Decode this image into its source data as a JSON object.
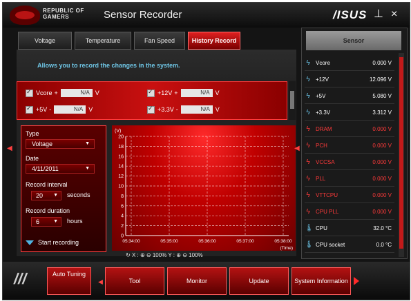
{
  "window": {
    "brand_line1": "REPUBLIC OF",
    "brand_line2": "GAMERS",
    "title": "Sensor Recorder",
    "vendor": "/ISUS",
    "minimize": "⊥",
    "close": "×"
  },
  "tabs": [
    {
      "label": "Voltage"
    },
    {
      "label": "Temperature"
    },
    {
      "label": "Fan Speed"
    },
    {
      "label": "History Record",
      "active": true
    }
  ],
  "description": "Allows you to record the changes in the system.",
  "voltage_items": [
    {
      "label": "Vcore",
      "value": "N/A",
      "unit": "V"
    },
    {
      "label": "+12V",
      "value": "N/A",
      "unit": "V"
    },
    {
      "label": "+5V",
      "value": "N/A",
      "unit": "V"
    },
    {
      "label": "+3.3V",
      "value": "N/A",
      "unit": "V"
    }
  ],
  "record_settings": {
    "type_label": "Type",
    "type_value": "Voltage",
    "date_label": "Date",
    "date_value": "4/11/2011",
    "interval_label": "Record interval",
    "interval_value": "20",
    "interval_unit": "seconds",
    "duration_label": "Record duration",
    "duration_value": "6",
    "duration_unit": "hours",
    "start_label": "Start recording"
  },
  "chart_data": {
    "type": "line",
    "title": "",
    "ylabel": "(V)",
    "ylim": [
      0,
      20
    ],
    "y_ticks": [
      0,
      2,
      4,
      6,
      8,
      10,
      12,
      14,
      16,
      18,
      20
    ],
    "x_ticks": [
      "05:34:00",
      "05:35:00",
      "05:36:00",
      "05:37:00",
      "05:38:00"
    ],
    "xlabel": "(Time)",
    "series": [],
    "grid": true
  },
  "graph_controls": {
    "x_label": "X :",
    "x_zoom": "100%",
    "y_label": "Y :",
    "y_zoom": "100%"
  },
  "sensors": {
    "header": "Sensor",
    "rows": [
      {
        "icon": "bolt-icon",
        "name": "Vcore",
        "value": "0.000",
        "unit": "V",
        "status": "normal"
      },
      {
        "icon": "bolt-icon",
        "name": "+12V",
        "value": "12.096",
        "unit": "V",
        "status": "normal"
      },
      {
        "icon": "bolt-icon",
        "name": "+5V",
        "value": "5.080",
        "unit": "V",
        "status": "normal"
      },
      {
        "icon": "bolt-icon",
        "name": "+3.3V",
        "value": "3.312",
        "unit": "V",
        "status": "normal"
      },
      {
        "icon": "bolt-icon",
        "name": "DRAM",
        "value": "0.000",
        "unit": "V",
        "status": "warning"
      },
      {
        "icon": "bolt-icon",
        "name": "PCH",
        "value": "0.000",
        "unit": "V",
        "status": "warning"
      },
      {
        "icon": "bolt-icon",
        "name": "VCCSA",
        "value": "0.000",
        "unit": "V",
        "status": "warning"
      },
      {
        "icon": "bolt-icon",
        "name": "PLL",
        "value": "0.000",
        "unit": "V",
        "status": "warning"
      },
      {
        "icon": "bolt-icon",
        "name": "VTTCPU",
        "value": "0.000",
        "unit": "V",
        "status": "warning"
      },
      {
        "icon": "bolt-icon",
        "name": "CPU PLL",
        "value": "0.000",
        "unit": "V",
        "status": "warning"
      },
      {
        "icon": "thermometer-icon",
        "name": "CPU",
        "value": "32.0",
        "unit": "°C",
        "status": "normal"
      },
      {
        "icon": "thermometer-icon",
        "name": "CPU socket",
        "value": "0.0",
        "unit": "°C",
        "status": "normal"
      }
    ]
  },
  "bottom_bar": {
    "auto_tuning": "Auto Tuning",
    "tool": "Tool",
    "monitor": "Monitor",
    "update": "Update",
    "system_info": "System Information"
  },
  "colors": {
    "accent": "#c91010",
    "info_text": "#6fc6e6",
    "warning": "#ff3a3a"
  }
}
